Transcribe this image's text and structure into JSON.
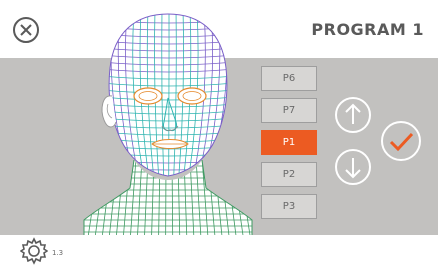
{
  "header": {
    "title": "PROGRAM 1",
    "close_icon": "close-icon"
  },
  "programs": [
    {
      "label": "P6",
      "selected": false
    },
    {
      "label": "P7",
      "selected": false
    },
    {
      "label": "P1",
      "selected": true
    },
    {
      "label": "P2",
      "selected": false
    },
    {
      "label": "P3",
      "selected": false
    }
  ],
  "controls": {
    "up_icon": "arrow-up-icon",
    "down_icon": "arrow-down-icon",
    "confirm_icon": "checkmark-icon"
  },
  "footer": {
    "version": "1.3",
    "settings_icon": "gear-icon"
  },
  "colors": {
    "accent": "#ec5b22",
    "band": "#c2c1bf",
    "wire_purple": "#7a5fc8",
    "wire_teal": "#2fb4b0",
    "wire_green": "#3f9a62",
    "wire_orange": "#e58a2d"
  }
}
